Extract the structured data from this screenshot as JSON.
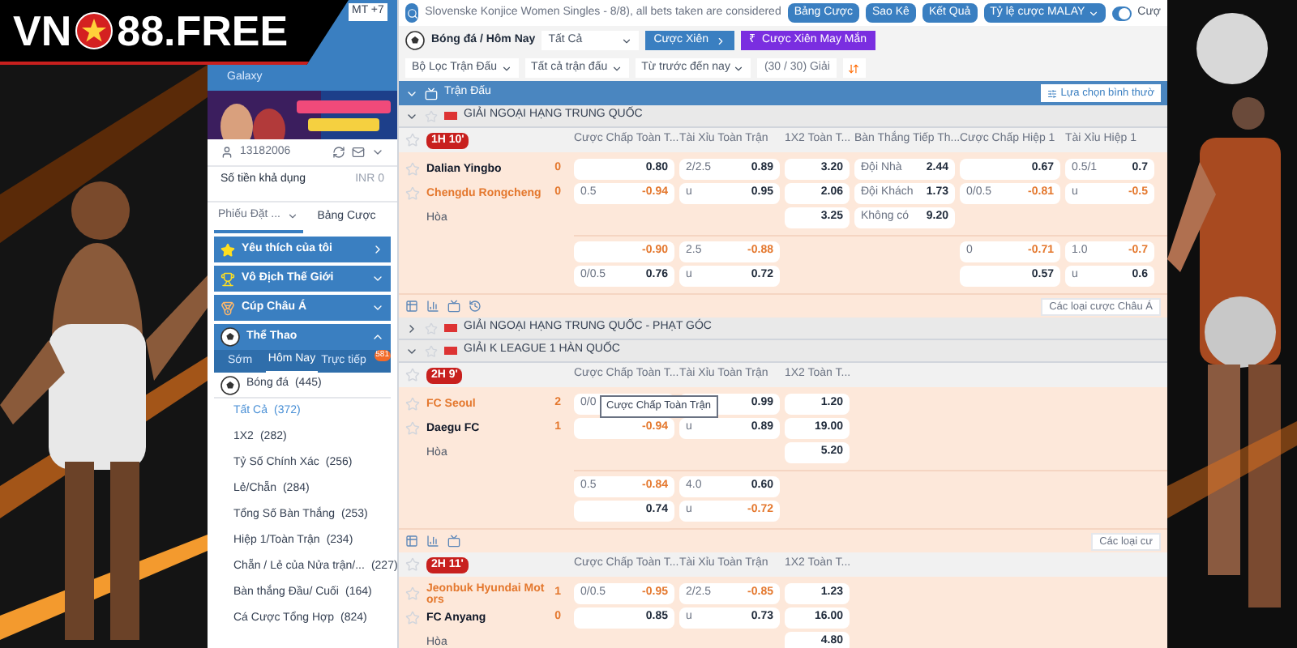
{
  "logo": {
    "left": "VN",
    "right": "88.FREE"
  },
  "timezone": "MT +7",
  "sidebar": {
    "promo_item": "Galaxy",
    "account": "13182006",
    "balance_label": "Số tiền khả dụng",
    "balance": "INR 0",
    "tabs": [
      {
        "label": "Phiếu Đặt ...",
        "selected": true
      },
      {
        "label": "Bảng Cược",
        "selected": false
      }
    ],
    "sections": [
      {
        "label": "Yêu thích của tôi",
        "kind": "link",
        "expanded": false
      },
      {
        "label": "Vô Địch Thế Giới",
        "kind": "group",
        "expanded": false
      },
      {
        "label": "Cúp Châu Á",
        "kind": "group",
        "expanded": false
      },
      {
        "label": "Thể Thao",
        "kind": "group",
        "expanded": true
      }
    ],
    "sport_tabs": [
      {
        "label": "Sớm",
        "selected": false
      },
      {
        "label": "Hôm Nay",
        "selected": true
      },
      {
        "label": "Trực tiếp",
        "selected": false
      }
    ],
    "live_badge": "581",
    "sport": "Bóng đá  (445)",
    "bet_types": [
      {
        "label": "Tất Cả",
        "count": "(372)",
        "selected": true
      },
      {
        "label": "1X2",
        "count": "(282)",
        "selected": false
      },
      {
        "label": "Tỷ Số Chính Xác",
        "count": "(256)",
        "selected": false
      },
      {
        "label": "Lẻ/Chẵn",
        "count": "(284)",
        "selected": false
      },
      {
        "label": "Tổng Số Bàn Thắng",
        "count": "(253)",
        "selected": false
      },
      {
        "label": "Hiệp 1/Toàn Trận",
        "count": "(234)",
        "selected": false
      },
      {
        "label": "Chẵn / Lẻ của Nửa trận/...",
        "count": "(227)",
        "selected": false
      },
      {
        "label": "Bàn thắng Đầu/ Cuối",
        "count": "(164)",
        "selected": false
      },
      {
        "label": "Cá Cược Tổng Hợp",
        "count": "(824)",
        "selected": false
      }
    ]
  },
  "main": {
    "ticker": "Slovenske Konjice Women Singles - 8/8), all bets taken are considered",
    "top_buttons": [
      "Bảng Cược",
      "Sao Kê",
      "Kết Quả"
    ],
    "odds_select": "Tỷ lệ cược MALAY",
    "toggle": {
      "on": true,
      "label": "Cượ"
    },
    "breadcrumb": "Bóng đá / Hôm Nay",
    "market_select": "Tất Cả",
    "parlay_button": "Cược Xiên",
    "lucky_button": {
      "symbol": "₹",
      "label": "Cược Xiên May Mắn"
    },
    "filters": [
      "Bộ Lọc Trận Đấu",
      "Tất cả trận đấu",
      "Từ trước đến nay"
    ],
    "league_count": "(30 / 30) Giải",
    "section": {
      "title": "Trận Đấu",
      "option_button": "Lựa chọn bình thườ"
    },
    "leagues": [
      {
        "name": "GIẢI NGOẠI HẠNG TRUNG QUỐC",
        "expanded": true,
        "matches": [
          {
            "time": "1H 10'",
            "columns": [
              "Cược Chấp Toàn T...",
              "Tài Xỉu Toàn Trận",
              "1X2 Toàn T...",
              "Bàn Thắng Tiếp Th...",
              "Cược Chấp Hiệp 1",
              "Tài Xỉu Hiệp 1"
            ],
            "teams": [
              {
                "name": "Dalian Yingbo",
                "score": "0",
                "favorite": false
              },
              {
                "name": "Chengdu Rongcheng",
                "score": "0",
                "favorite": true
              },
              {
                "name": "Hòa"
              }
            ],
            "rows": [
              [
                {
                  "odds": "0.80",
                  "negative": false
                },
                {
                  "line": "2/2.5",
                  "odds": "0.89",
                  "negative": false
                },
                {
                  "odds": "3.20",
                  "negative": false
                },
                {
                  "line": "Đội Nhà",
                  "odds": "2.44",
                  "negative": false
                },
                {
                  "odds": "0.67",
                  "negative": false
                },
                {
                  "line": "0.5/1",
                  "odds": "0.7",
                  "negative": false
                }
              ],
              [
                {
                  "line": "0.5",
                  "odds": "-0.94",
                  "negative": true
                },
                {
                  "line": "u",
                  "odds": "0.95",
                  "negative": false
                },
                {
                  "odds": "2.06",
                  "negative": false
                },
                {
                  "line": "Đội Khách",
                  "odds": "1.73",
                  "negative": false
                },
                {
                  "line": "0/0.5",
                  "odds": "-0.81",
                  "negative": true
                },
                {
                  "line": "u",
                  "odds": "-0.5",
                  "negative": true
                }
              ],
              [
                null,
                null,
                {
                  "odds": "3.25",
                  "negative": false
                },
                {
                  "line": "Không có",
                  "odds": "9.20",
                  "negative": false
                },
                null,
                null
              ]
            ],
            "extra_rows": [
              [
                {
                  "odds": "-0.90",
                  "negative": true
                },
                {
                  "line": "2.5",
                  "odds": "-0.88",
                  "negative": true
                },
                null,
                null,
                {
                  "line": "0",
                  "odds": "-0.71",
                  "negative": true
                },
                {
                  "line": "1.0",
                  "odds": "-0.7",
                  "negative": true
                }
              ],
              [
                {
                  "line": "0/0.5",
                  "odds": "0.76",
                  "negative": false
                },
                {
                  "line": "u",
                  "odds": "0.72",
                  "negative": false
                },
                null,
                null,
                {
                  "odds": "0.57",
                  "negative": false
                },
                {
                  "line": "u",
                  "odds": "0.6",
                  "negative": false
                }
              ]
            ],
            "footer": {
              "button": "Các loại cược Châu Á",
              "history_icon": true
            }
          }
        ]
      },
      {
        "name": "GIẢI NGOẠI HẠNG TRUNG QUỐC - PHẠT GÓC",
        "expanded": false
      },
      {
        "name": "GIẢI K LEAGUE 1 HÀN QUỐC",
        "expanded": true,
        "matches": [
          {
            "time": "2H 9'",
            "columns": [
              "Cược Chấp Toàn T...",
              "Tài Xỉu Toàn Trận",
              "1X2 Toàn T..."
            ],
            "teams": [
              {
                "name": "FC Seoul",
                "score": "2",
                "favorite": true
              },
              {
                "name": "Daegu FC",
                "score": "1",
                "favorite": false
              },
              {
                "name": "Hòa"
              }
            ],
            "tooltip": "Cược Chấp Toàn Trận",
            "rows": [
              [
                {
                  "line": "0/0",
                  "negative": false
                },
                {
                  "odds": "0.99",
                  "negative": false
                },
                {
                  "odds": "1.20",
                  "negative": false
                }
              ],
              [
                {
                  "odds": "-0.94",
                  "negative": true
                },
                {
                  "line": "u",
                  "odds": "0.89",
                  "negative": false
                },
                {
                  "odds": "19.00",
                  "negative": false
                }
              ],
              [
                null,
                null,
                {
                  "odds": "5.20",
                  "negative": false
                }
              ]
            ],
            "extra_rows": [
              [
                {
                  "line": "0.5",
                  "odds": "-0.84",
                  "negative": true
                },
                {
                  "line": "4.0",
                  "odds": "0.60",
                  "negative": false
                },
                null
              ],
              [
                {
                  "odds": "0.74",
                  "negative": false
                },
                {
                  "line": "u",
                  "odds": "-0.72",
                  "negative": true
                },
                null
              ]
            ],
            "footer": {
              "button": "Các loại cư",
              "history_icon": false
            }
          },
          {
            "time": "2H 11'",
            "columns": [
              "Cược Chấp Toàn T...",
              "Tài Xỉu Toàn Trận",
              "1X2 Toàn T..."
            ],
            "teams": [
              {
                "name": "Jeonbuk Hyundai Mot ors",
                "score": "1",
                "favorite": true
              },
              {
                "name": "FC Anyang",
                "score": "0",
                "favorite": false
              },
              {
                "name": "Hòa"
              }
            ],
            "rows": [
              [
                {
                  "line": "0/0.5",
                  "odds": "-0.95",
                  "negative": true
                },
                {
                  "line": "2/2.5",
                  "odds": "-0.85",
                  "negative": true
                },
                {
                  "odds": "1.23",
                  "negative": false
                }
              ],
              [
                {
                  "odds": "0.85",
                  "negative": false
                },
                {
                  "line": "u",
                  "odds": "0.73",
                  "negative": false
                },
                {
                  "odds": "16.00",
                  "negative": false
                }
              ],
              [
                null,
                null,
                {
                  "odds": "4.80",
                  "negative": false
                }
              ]
            ]
          }
        ]
      }
    ]
  }
}
